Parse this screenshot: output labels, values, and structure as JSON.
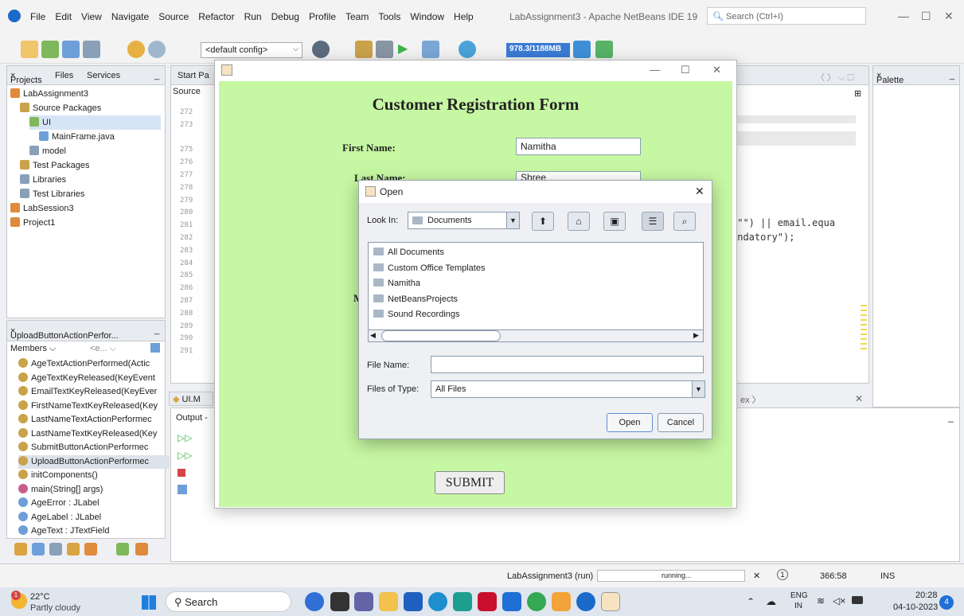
{
  "menubar": {
    "items": [
      "File",
      "Edit",
      "View",
      "Navigate",
      "Source",
      "Refactor",
      "Run",
      "Debug",
      "Profile",
      "Team",
      "Tools",
      "Window",
      "Help"
    ],
    "window_title": "LabAssignment3 - Apache NetBeans IDE 19",
    "search_placeholder": "Search (Ctrl+I)"
  },
  "toolbar": {
    "config": "<default config>",
    "memory": "978.3/1188MB"
  },
  "projects_panel": {
    "tabs": [
      "Projects",
      "Files",
      "Services"
    ],
    "tree": [
      {
        "label": "LabAssignment3",
        "indent": 1
      },
      {
        "label": "Source Packages",
        "indent": 2
      },
      {
        "label": "UI",
        "indent": 3
      },
      {
        "label": "MainFrame.java",
        "indent": 4
      },
      {
        "label": "model",
        "indent": 3
      },
      {
        "label": "Test Packages",
        "indent": 2
      },
      {
        "label": "Libraries",
        "indent": 2
      },
      {
        "label": "Test Libraries",
        "indent": 2
      },
      {
        "label": "LabSession3",
        "indent": 1
      },
      {
        "label": "Project1",
        "indent": 1
      }
    ]
  },
  "navigator": {
    "title": "UploadButtonActionPerfor...",
    "members_label": "Members",
    "filter": "<e...",
    "items": [
      "AgeTextActionPerformed(Actic",
      "AgeTextKeyReleased(KeyEvent",
      "EmailTextKeyReleased(KeyEver",
      "FirstNameTextKeyReleased(Key",
      "LastNameTextActionPerformec",
      "LastNameTextKeyReleased(Key",
      "SubmitButtonActionPerformec",
      "UploadButtonActionPerformec",
      "initComponents()",
      "main(String[] args)",
      "AgeError : JLabel",
      "AgeLabel : JLabel",
      "AgeText : JTextField"
    ]
  },
  "editor": {
    "tabs": {
      "start": "Start Pa",
      "source": "Source"
    },
    "line_numbers": [
      "272",
      "273",
      "",
      "275",
      "276",
      "277",
      "278",
      "279",
      "280",
      "281",
      "282",
      "283",
      "284",
      "285",
      "286",
      "287",
      "288",
      "289",
      "290",
      "291"
    ],
    "code_lines": [
      ":\"\") || email.equa",
      "andatory\");"
    ],
    "bottom_tab": "UI.M",
    "bottom_right": "ex"
  },
  "palette": {
    "title": "Palette"
  },
  "output": {
    "title": "Output -"
  },
  "jframe": {
    "form_title": "Customer Registration Form",
    "first_name_label": "First Name:",
    "first_name_value": "Namitha",
    "last_name_label": "Last Name:",
    "last_name_value": "Shree",
    "partial_label": "M",
    "submit": "SUBMIT"
  },
  "open_dialog": {
    "title": "Open",
    "look_in_label": "Look In:",
    "look_in_value": "Documents",
    "folders": [
      "All Documents",
      "Custom Office Templates",
      "Namitha",
      "NetBeansProjects",
      "Sound Recordings"
    ],
    "file_name_label": "File Name:",
    "file_name_value": "",
    "files_of_type_label": "Files of Type:",
    "files_of_type_value": "All Files",
    "open_button": "Open",
    "cancel_button": "Cancel"
  },
  "statusbar": {
    "run_label": "LabAssignment3 (run)",
    "running": "running...",
    "position": "366:58",
    "mode": "INS"
  },
  "taskbar": {
    "temperature": "22°C",
    "weather": "Partly cloudy",
    "search": "Search",
    "lang": "ENG",
    "region": "IN",
    "time": "20:28",
    "date": "04-10-2023",
    "notification_count": "4",
    "weather_badge": "1"
  },
  "colors": {
    "form_bg": "#c6f7a2",
    "accent": "#3a7bd5"
  }
}
